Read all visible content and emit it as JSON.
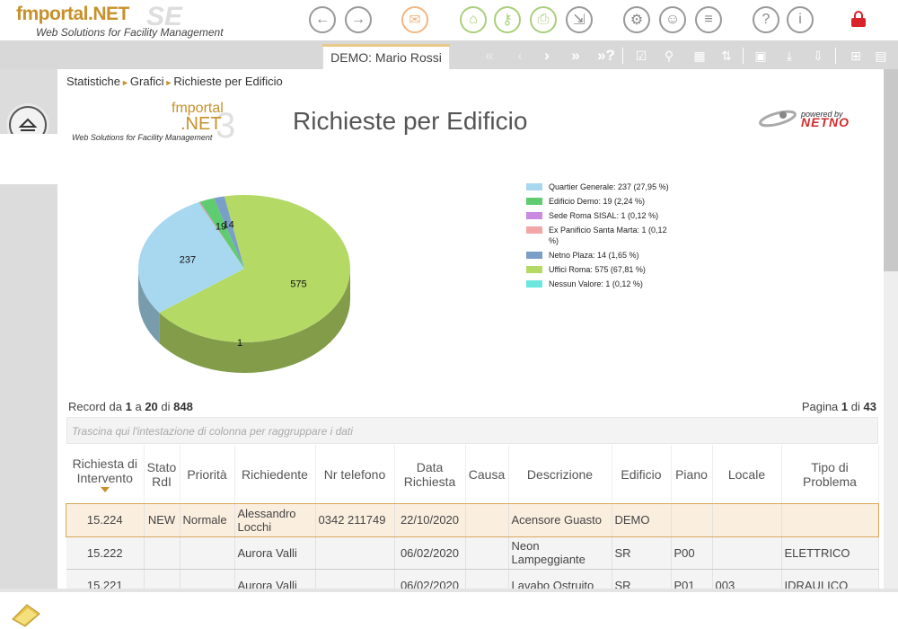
{
  "app": {
    "brand_main": "fmportal.NET",
    "brand_suffix": "SE",
    "tagline": "Web Solutions for Facility Management"
  },
  "topbar": {
    "buttons": [
      {
        "name": "back-button",
        "icon": "arrow-left-icon",
        "glyph": "←"
      },
      {
        "name": "forward-button",
        "icon": "arrow-right-icon",
        "glyph": "→"
      },
      {
        "name": "mail-button",
        "icon": "mail-icon",
        "glyph": "✉"
      },
      {
        "name": "home-button",
        "icon": "home-icon",
        "glyph": "⌂"
      },
      {
        "name": "key-button",
        "icon": "key-icon",
        "glyph": "⚷"
      },
      {
        "name": "print-button",
        "icon": "print-icon",
        "glyph": "⎙"
      },
      {
        "name": "export-button",
        "icon": "export-icon",
        "glyph": "⇲"
      },
      {
        "name": "settings-button",
        "icon": "gear-icon",
        "glyph": "⚙"
      },
      {
        "name": "user-button",
        "icon": "user-icon",
        "glyph": "☺"
      },
      {
        "name": "database-button",
        "icon": "database-icon",
        "glyph": "≡"
      },
      {
        "name": "help-button",
        "icon": "help-icon",
        "glyph": "?"
      },
      {
        "name": "info-button",
        "icon": "info-icon",
        "glyph": "i"
      }
    ]
  },
  "tab": {
    "label": "DEMO: Mario Rossi"
  },
  "toolbar": {
    "nav": [
      {
        "name": "first-page-button",
        "icon": "double-chevron-left-icon",
        "glyph": "«",
        "dim": true
      },
      {
        "name": "prev-page-button",
        "icon": "chevron-left-icon",
        "glyph": "‹",
        "dim": true
      },
      {
        "name": "next-page-button",
        "icon": "chevron-right-icon",
        "glyph": "›",
        "dim": false
      },
      {
        "name": "last-page-button",
        "icon": "double-chevron-right-icon",
        "glyph": "»",
        "dim": false
      },
      {
        "name": "goto-page-button",
        "icon": "goto-page-icon",
        "glyph": "»?",
        "dim": false
      }
    ],
    "tools": [
      {
        "name": "checklist-button",
        "icon": "checklist-icon",
        "glyph": "☑"
      },
      {
        "name": "filter-button",
        "icon": "filter-icon",
        "glyph": "⚲"
      },
      {
        "name": "columns-button",
        "icon": "columns-icon",
        "glyph": "▦"
      },
      {
        "name": "sort-az-button",
        "icon": "sort-az-icon",
        "glyph": "⇅"
      },
      {
        "name": "save-button",
        "icon": "save-icon",
        "glyph": "▣"
      },
      {
        "name": "import-button",
        "icon": "import-icon",
        "glyph": "⤓"
      },
      {
        "name": "download-button",
        "icon": "download-icon",
        "glyph": "⇩"
      },
      {
        "name": "tree-button",
        "icon": "tree-icon",
        "glyph": "⊞"
      },
      {
        "name": "layout-button",
        "icon": "layout-icon",
        "glyph": "▤"
      }
    ]
  },
  "sidebar": {
    "items": [
      {
        "name": "sidebar-item-search",
        "icon": "search-icon",
        "active": false
      },
      {
        "name": "sidebar-item-list",
        "icon": "list-icon",
        "active": true
      },
      {
        "name": "sidebar-item-users",
        "icon": "users-icon",
        "active": false
      },
      {
        "name": "sidebar-item-favorites",
        "icon": "user-star-icon",
        "active": false
      },
      {
        "name": "sidebar-item-plans",
        "icon": "drafting-icon",
        "active": false
      },
      {
        "name": "sidebar-item-map",
        "icon": "map-icon",
        "active": false
      }
    ]
  },
  "breadcrumb": [
    "Statistiche",
    "Grafici",
    "Richieste per Edificio"
  ],
  "report": {
    "title": "Richieste per Edificio",
    "logo_main": "fmportal",
    "logo_net": ".NET",
    "logo_num": "3",
    "logo_tagline": "Web Solutions for Facility Management",
    "powered_by": "powered by",
    "powered_name": "NETNO"
  },
  "chart_data": {
    "type": "pie",
    "title": "",
    "labels": [
      "Quartier Generale: 237 (27,95 %)",
      "Edificio Demo: 19 (2,24 %)",
      "Sede Roma SISAL: 1 (0,12 %)",
      "Ex Panificio Santa Marta: 1 (0,12 %)",
      "Netno Plaza: 14 (1,65 %)",
      "Uffici Roma: 575 (67,81 %)",
      "Nessun Valore: 1 (0,12 %)"
    ],
    "values": [
      237,
      19,
      1,
      1,
      14,
      575,
      1
    ],
    "colors": [
      "#a8d8ef",
      "#5fcd6f",
      "#c98ae0",
      "#f4a5a5",
      "#7a9fc6",
      "#b4d965",
      "#6de6dd"
    ],
    "data_labels": [
      "237",
      "19",
      "",
      "",
      "14",
      "575",
      "1"
    ],
    "legend": "right"
  },
  "grid": {
    "records_label": "Record da",
    "records_from": "1",
    "records_to_label": "a",
    "records_to": "20",
    "records_of_label": "di",
    "records_total": "848",
    "page_label": "Pagina",
    "page_current": "1",
    "page_of_label": "di",
    "page_total": "43",
    "group_placeholder": "Trascina qui l'intestazione di colonna per raggruppare i dati",
    "columns": [
      "Richiesta di Intervento",
      "Stato RdI",
      "Priorità",
      "Richiedente",
      "Nr telefono",
      "Data Richiesta",
      "Causa",
      "Descrizione",
      "Edificio",
      "Piano",
      "Locale",
      "Tipo di Problema"
    ],
    "rows": [
      {
        "id": "15.224",
        "status_icon": "new-badge-icon",
        "priority": "Normale",
        "requester": "Alessandro Locchi",
        "phone": "0342 211749",
        "date": "22/10/2020",
        "cause": "",
        "description": "Acensore Guasto",
        "building": "DEMO",
        "floor": "",
        "room": "",
        "problem": ""
      },
      {
        "id": "15.222",
        "status_icon": "target-gear-icon",
        "priority": "",
        "requester": "Aurora Valli",
        "phone": "",
        "date": "06/02/2020",
        "cause": "",
        "description": "Neon Lampeggiante",
        "building": "SR",
        "floor": "P00",
        "room": "",
        "problem": "ELETTRICO"
      },
      {
        "id": "15.221",
        "status_icon": "green-gear-icon",
        "priority": "",
        "requester": "Aurora Valli",
        "phone": "",
        "date": "06/02/2020",
        "cause": "",
        "description": "Lavabo Ostruito",
        "building": "SR",
        "floor": "P01",
        "room": "003",
        "problem": "IDRAULICO"
      }
    ]
  }
}
